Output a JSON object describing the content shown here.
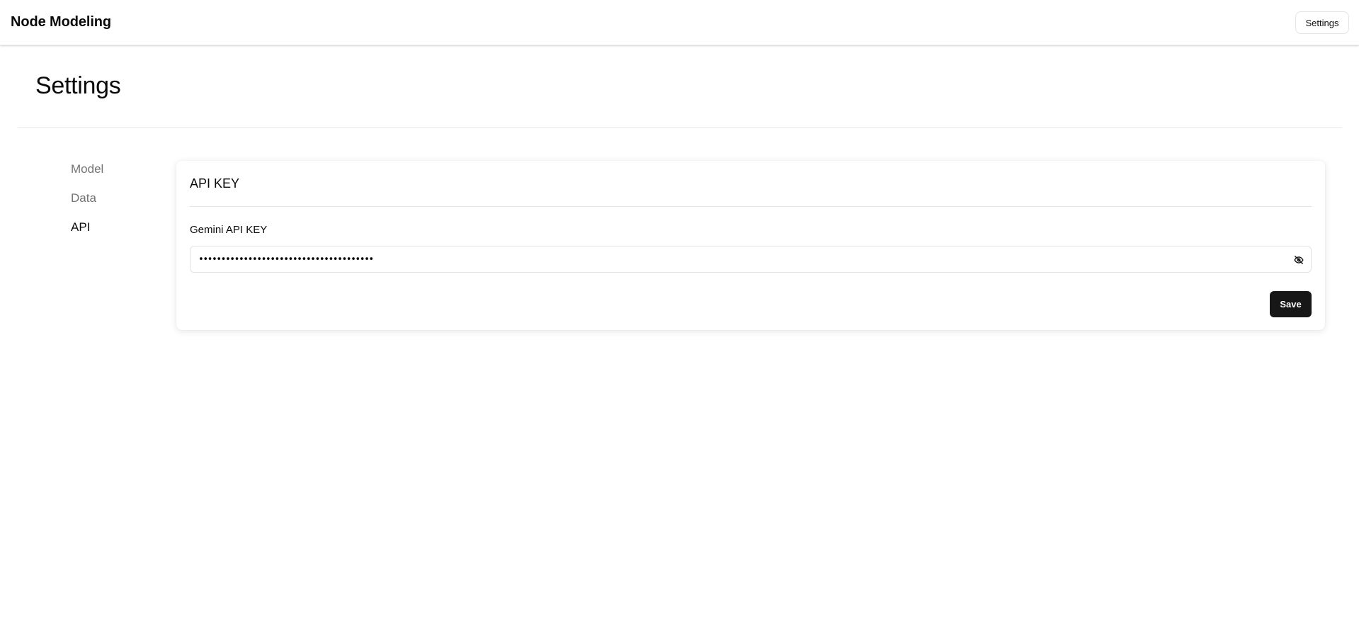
{
  "header": {
    "app_title": "Node Modeling",
    "settings_button": "Settings"
  },
  "page": {
    "title": "Settings"
  },
  "sidebar": {
    "items": [
      {
        "label": "Model",
        "active": false
      },
      {
        "label": "Data",
        "active": false
      },
      {
        "label": "API",
        "active": true
      }
    ]
  },
  "card": {
    "title": "API KEY",
    "field_label": "Gemini API KEY",
    "field_value": "•••••••••••••••••••••••••••••••••••••••",
    "visibility_icon": "eye-off-icon",
    "save_label": "Save"
  },
  "colors": {
    "primary_button": "#171717",
    "muted_text": "#737373",
    "border": "#e3e3e3"
  }
}
